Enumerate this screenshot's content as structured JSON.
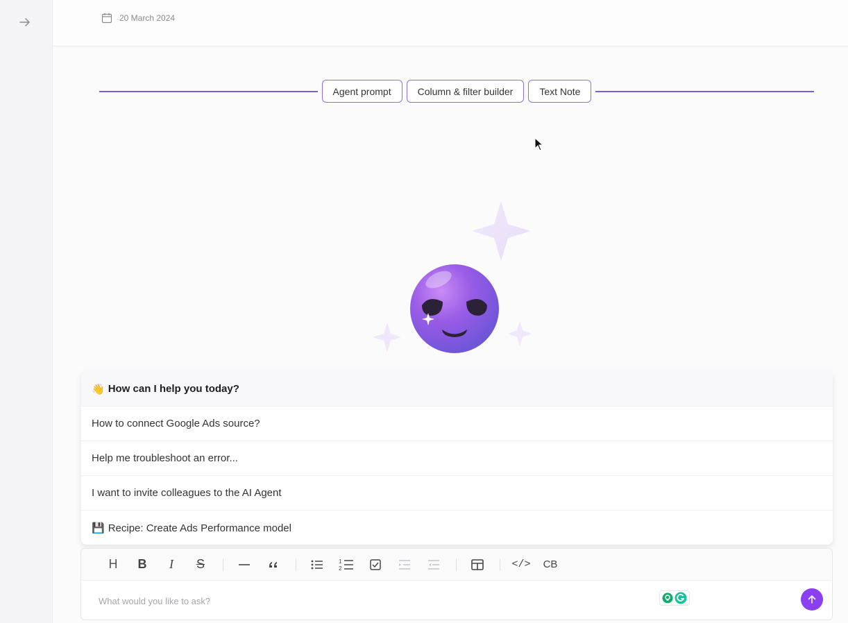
{
  "sidebar": {
    "expand_icon": "arrow-right-icon"
  },
  "header": {
    "date": "20 March 2024",
    "date_icon": "calendar-icon"
  },
  "insert_bar": {
    "buttons": [
      "Agent prompt",
      "Column & filter builder",
      "Text Note"
    ],
    "accent": "#7b5ce0"
  },
  "hero": {
    "icon": "alien-mascot-icon"
  },
  "suggestions": {
    "header_emoji": "👋",
    "header": "How can I help you today?",
    "items": [
      {
        "emoji": "",
        "label": "How to connect Google Ads source?"
      },
      {
        "emoji": "",
        "label": "Help me troubleshoot an error..."
      },
      {
        "emoji": "",
        "label": "I want to invite colleagues to the AI Agent"
      },
      {
        "emoji": "💾",
        "label": "Recipe: Create Ads Performance model"
      }
    ]
  },
  "composer": {
    "toolbar": {
      "heading": "H",
      "bold": "B",
      "italic": "I",
      "strike": "S",
      "code": "</>",
      "codeblock": "CB"
    },
    "placeholder": "What would you like to ask?",
    "send_color": "#8a3ff0"
  }
}
